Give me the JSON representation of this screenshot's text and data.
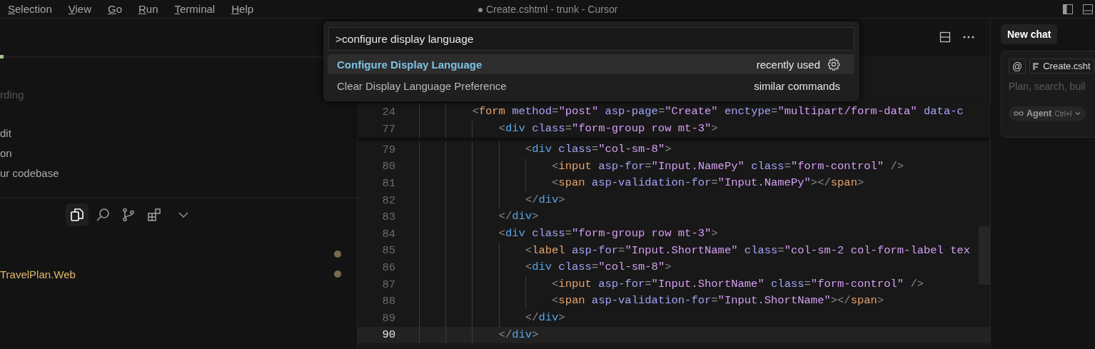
{
  "menu": [
    {
      "label": "Selection"
    },
    {
      "label": "View"
    },
    {
      "label": "Go"
    },
    {
      "label": "Run"
    },
    {
      "label": "Terminal"
    },
    {
      "label": "Help"
    }
  ],
  "window": {
    "title": "● Create.cshtml - trunk - Cursor"
  },
  "sidebar": {
    "top_items": [
      {
        "label": "rding",
        "disabled": true
      },
      {
        "label": "dit",
        "disabled": false
      },
      {
        "label": "on",
        "disabled": false
      },
      {
        "label": "ur codebase",
        "disabled": false
      }
    ],
    "activity_tabs": [
      {
        "kind": "files",
        "selected": true
      },
      {
        "kind": "search",
        "selected": false
      },
      {
        "kind": "source-control",
        "selected": false
      },
      {
        "kind": "extensions",
        "selected": false
      }
    ],
    "tree": [
      {
        "modified": true
      },
      {
        "label": "TravelPlan.Web",
        "modified": true
      }
    ]
  },
  "editor": {
    "sticky_lines": [
      {
        "number": "24",
        "current": false,
        "tokens": [
          {
            "kind": "punct",
            "text": "        <"
          },
          {
            "kind": "tag",
            "text": "form"
          },
          {
            "kind": "attr",
            "text": " method"
          },
          {
            "kind": "punct",
            "text": "="
          },
          {
            "kind": "string",
            "text": "\"post\""
          },
          {
            "kind": "attr",
            "text": " asp-page"
          },
          {
            "kind": "punct",
            "text": "="
          },
          {
            "kind": "string",
            "text": "\"Create\""
          },
          {
            "kind": "attr",
            "text": " enctype"
          },
          {
            "kind": "punct",
            "text": "="
          },
          {
            "kind": "string",
            "text": "\"multipart/form-data\""
          },
          {
            "kind": "attr",
            "text": " data-c"
          }
        ]
      },
      {
        "number": "77",
        "current": false,
        "tokens": [
          {
            "kind": "punct",
            "text": "            <"
          },
          {
            "kind": "html-tag",
            "text": "div"
          },
          {
            "kind": "attr",
            "text": " class"
          },
          {
            "kind": "punct",
            "text": "="
          },
          {
            "kind": "string",
            "text": "\"form-group row mt-3\""
          },
          {
            "kind": "punct",
            "text": ">"
          }
        ]
      }
    ],
    "lines": [
      {
        "number": "79",
        "current": false,
        "tokens": [
          {
            "kind": "punct",
            "text": "                <"
          },
          {
            "kind": "html-tag",
            "text": "div"
          },
          {
            "kind": "attr",
            "text": " class"
          },
          {
            "kind": "punct",
            "text": "="
          },
          {
            "kind": "string",
            "text": "\"col-sm-8\""
          },
          {
            "kind": "punct",
            "text": ">"
          }
        ]
      },
      {
        "number": "80",
        "current": false,
        "tokens": [
          {
            "kind": "punct",
            "text": "                    <"
          },
          {
            "kind": "tag",
            "text": "input"
          },
          {
            "kind": "attr",
            "text": " asp-for"
          },
          {
            "kind": "punct",
            "text": "="
          },
          {
            "kind": "string",
            "text": "\"Input.NamePy\""
          },
          {
            "kind": "attr",
            "text": " class"
          },
          {
            "kind": "punct",
            "text": "="
          },
          {
            "kind": "string",
            "text": "\"form-control\""
          },
          {
            "kind": "punct",
            "text": " />"
          }
        ]
      },
      {
        "number": "81",
        "current": false,
        "tokens": [
          {
            "kind": "punct",
            "text": "                    <"
          },
          {
            "kind": "tag",
            "text": "span"
          },
          {
            "kind": "attr",
            "text": " asp-validation-for"
          },
          {
            "kind": "punct",
            "text": "="
          },
          {
            "kind": "string",
            "text": "\"Input.NamePy\""
          },
          {
            "kind": "punct",
            "text": "></"
          },
          {
            "kind": "tag",
            "text": "span"
          },
          {
            "kind": "punct",
            "text": ">"
          }
        ]
      },
      {
        "number": "82",
        "current": false,
        "tokens": [
          {
            "kind": "punct",
            "text": "                </"
          },
          {
            "kind": "html-tag",
            "text": "div"
          },
          {
            "kind": "punct",
            "text": ">"
          }
        ]
      },
      {
        "number": "83",
        "current": false,
        "tokens": [
          {
            "kind": "punct",
            "text": "            </"
          },
          {
            "kind": "html-tag",
            "text": "div"
          },
          {
            "kind": "punct",
            "text": ">"
          }
        ]
      },
      {
        "number": "84",
        "current": false,
        "tokens": [
          {
            "kind": "punct",
            "text": "            <"
          },
          {
            "kind": "html-tag",
            "text": "div"
          },
          {
            "kind": "attr",
            "text": " class"
          },
          {
            "kind": "punct",
            "text": "="
          },
          {
            "kind": "string",
            "text": "\"form-group row mt-3\""
          },
          {
            "kind": "punct",
            "text": ">"
          }
        ]
      },
      {
        "number": "85",
        "current": false,
        "tokens": [
          {
            "kind": "punct",
            "text": "                <"
          },
          {
            "kind": "tag",
            "text": "label"
          },
          {
            "kind": "attr",
            "text": " asp-for"
          },
          {
            "kind": "punct",
            "text": "="
          },
          {
            "kind": "string",
            "text": "\"Input.ShortName\""
          },
          {
            "kind": "attr",
            "text": " class"
          },
          {
            "kind": "punct",
            "text": "="
          },
          {
            "kind": "string",
            "text": "\"col-sm-2 col-form-label tex"
          }
        ]
      },
      {
        "number": "86",
        "current": false,
        "tokens": [
          {
            "kind": "punct",
            "text": "                <"
          },
          {
            "kind": "html-tag",
            "text": "div"
          },
          {
            "kind": "attr",
            "text": " class"
          },
          {
            "kind": "punct",
            "text": "="
          },
          {
            "kind": "string",
            "text": "\"col-sm-8\""
          },
          {
            "kind": "punct",
            "text": ">"
          }
        ]
      },
      {
        "number": "87",
        "current": false,
        "tokens": [
          {
            "kind": "punct",
            "text": "                    <"
          },
          {
            "kind": "tag",
            "text": "input"
          },
          {
            "kind": "attr",
            "text": " asp-for"
          },
          {
            "kind": "punct",
            "text": "="
          },
          {
            "kind": "string",
            "text": "\"Input.ShortName\""
          },
          {
            "kind": "attr",
            "text": " class"
          },
          {
            "kind": "punct",
            "text": "="
          },
          {
            "kind": "string",
            "text": "\"form-control\""
          },
          {
            "kind": "punct",
            "text": " />"
          }
        ]
      },
      {
        "number": "88",
        "current": false,
        "tokens": [
          {
            "kind": "punct",
            "text": "                    <"
          },
          {
            "kind": "tag",
            "text": "span"
          },
          {
            "kind": "attr",
            "text": " asp-validation-for"
          },
          {
            "kind": "punct",
            "text": "="
          },
          {
            "kind": "string",
            "text": "\"Input.ShortName\""
          },
          {
            "kind": "punct",
            "text": "></"
          },
          {
            "kind": "tag",
            "text": "span"
          },
          {
            "kind": "punct",
            "text": ">"
          }
        ]
      },
      {
        "number": "89",
        "current": false,
        "tokens": [
          {
            "kind": "punct",
            "text": "                </"
          },
          {
            "kind": "html-tag",
            "text": "div"
          },
          {
            "kind": "punct",
            "text": ">"
          }
        ]
      },
      {
        "number": "90",
        "current": true,
        "tokens": [
          {
            "kind": "punct",
            "text": "            </"
          },
          {
            "kind": "html-tag",
            "text": "div"
          },
          {
            "kind": "punct",
            "text": ">"
          }
        ]
      }
    ]
  },
  "command_palette": {
    "input": {
      "value": ">configure display language"
    },
    "items": [
      {
        "label": "Configure Display Language",
        "detail": "recently used",
        "selected": true
      },
      {
        "label": "Clear Display Language Preference",
        "detail": "similar commands",
        "selected": false
      }
    ]
  },
  "chat": {
    "tab": "New chat",
    "mention": "@",
    "file_chip": "Create.csht",
    "placeholder": "Plan, search, buil",
    "mode": {
      "label": "Agent",
      "shortcut": "Ctrl+I"
    }
  }
}
